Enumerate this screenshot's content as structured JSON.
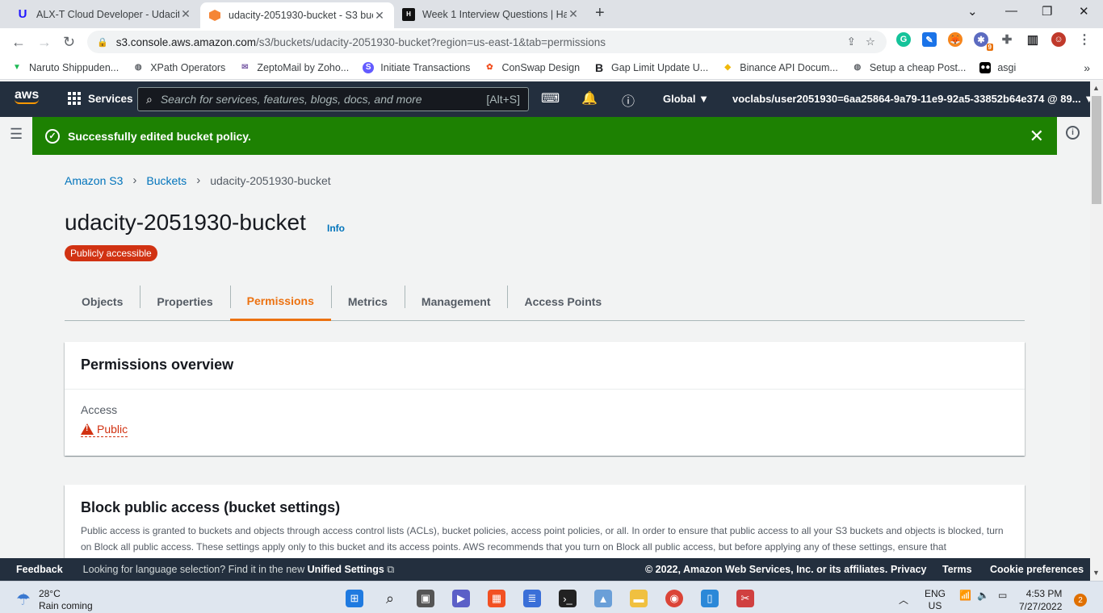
{
  "browser": {
    "tabs": [
      {
        "title": "ALX-T Cloud Developer - Udacity",
        "icon": "udacity-icon"
      },
      {
        "title": "udacity-2051930-bucket - S3 buc",
        "icon": "aws-s3-icon"
      },
      {
        "title": "Week 1 Interview Questions | Ha",
        "icon": "hackmd-icon"
      }
    ],
    "url_host": "s3.console.aws.amazon.com",
    "url_path": "/s3/buckets/udacity-2051930-bucket?region=us-east-1&tab=permissions",
    "extension_badge": "9"
  },
  "bookmarks": [
    "Naruto Shippuden...",
    "XPath Operators",
    "ZeptoMail by Zoho...",
    "Initiate Transactions",
    "ConSwap Design",
    "Gap Limit Update U...",
    "Binance API Docum...",
    "Setup a cheap Post...",
    "asgi"
  ],
  "awsnav": {
    "logo": "aws",
    "services": "Services",
    "search_placeholder": "Search for services, features, blogs, docs, and more",
    "search_shortcut": "[Alt+S]",
    "region": "Global",
    "account": "voclabs/user2051930=6aa25864-9a79-11e9-92a5-33852b64e374 @ 89..."
  },
  "flash": {
    "message": "Successfully edited bucket policy.",
    "color": "#1d8102"
  },
  "breadcrumb": {
    "root": "Amazon S3",
    "mid": "Buckets",
    "current": "udacity-2051930-bucket"
  },
  "page": {
    "title": "udacity-2051930-bucket",
    "info": "Info",
    "badge": "Publicly accessible",
    "tabs": [
      "Objects",
      "Properties",
      "Permissions",
      "Metrics",
      "Management",
      "Access Points"
    ],
    "active_tab": "Permissions"
  },
  "permissions_overview": {
    "heading": "Permissions overview",
    "access_label": "Access",
    "access_value": "Public"
  },
  "block_public_access": {
    "heading": "Block public access (bucket settings)",
    "description": "Public access is granted to buckets and objects through access control lists (ACLs), bucket policies, access point policies, or all. In order to ensure that public access to all your S3 buckets and objects is blocked, turn on Block all public access. These settings apply only to this bucket and its access points. AWS recommends that you turn on Block all public access, but before applying any of these settings, ensure that"
  },
  "footer": {
    "feedback": "Feedback",
    "lang_text": "Looking for language selection? Find it in the new",
    "lang_link": "Unified Settings",
    "copyright": "© 2022, Amazon Web Services, Inc. or its affiliates.",
    "privacy": "Privacy",
    "terms": "Terms",
    "cookies": "Cookie preferences"
  },
  "taskbar": {
    "temperature": "28°C",
    "weather": "Rain coming",
    "lang1": "ENG",
    "lang2": "US",
    "time": "4:53 PM",
    "date": "7/27/2022",
    "notifications": "2"
  }
}
